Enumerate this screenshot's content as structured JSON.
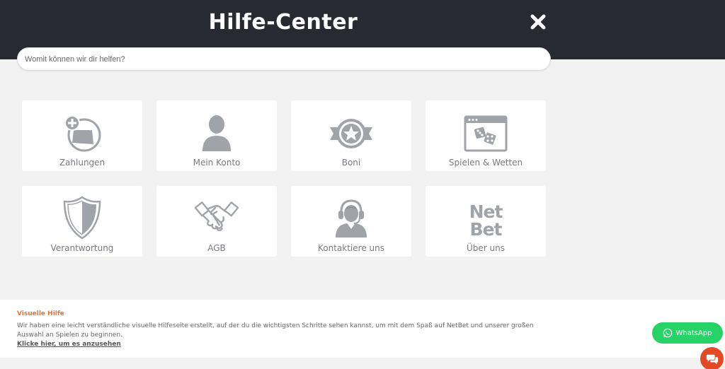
{
  "header": {
    "title": "Hilfe-Center",
    "close_icon": "close-icon"
  },
  "search": {
    "placeholder": "Womit können wir dir helfen?",
    "value": ""
  },
  "categories": [
    {
      "label": "Zahlungen",
      "icon": "payments-icon"
    },
    {
      "label": "Mein Konto",
      "icon": "user-icon"
    },
    {
      "label": "Boni",
      "icon": "star-badge-icon"
    },
    {
      "label": "Spielen & Wetten",
      "icon": "dice-window-icon"
    },
    {
      "label": "Verantwortung",
      "icon": "shield-icon"
    },
    {
      "label": "AGB",
      "icon": "handshake-icon"
    },
    {
      "label": "Kontaktiere uns",
      "icon": "support-agent-icon"
    },
    {
      "label": "Über uns",
      "icon": "netbet-logo-icon"
    }
  ],
  "logo": {
    "line1": "Net",
    "line2": "Bet"
  },
  "footer": {
    "title": "Visuelle Hilfe",
    "text": "Wir haben eine leicht verständliche visuelle Hilfeseite erstellt, auf der du die wichtigsten Schritte sehen kannst, um mit dem Spaß auf NetBet und unserer großen Auswahl an Spielen zu beginnen.",
    "link": "Klicke hier, um es anzusehen"
  },
  "whatsapp": {
    "label": "WhatsApp"
  },
  "colors": {
    "header_bg": "#272a31",
    "icon_gray": "#a0a3a8",
    "accent_orange": "#e2773d",
    "whatsapp_green": "#25d366",
    "chat_red": "#e24a26"
  }
}
